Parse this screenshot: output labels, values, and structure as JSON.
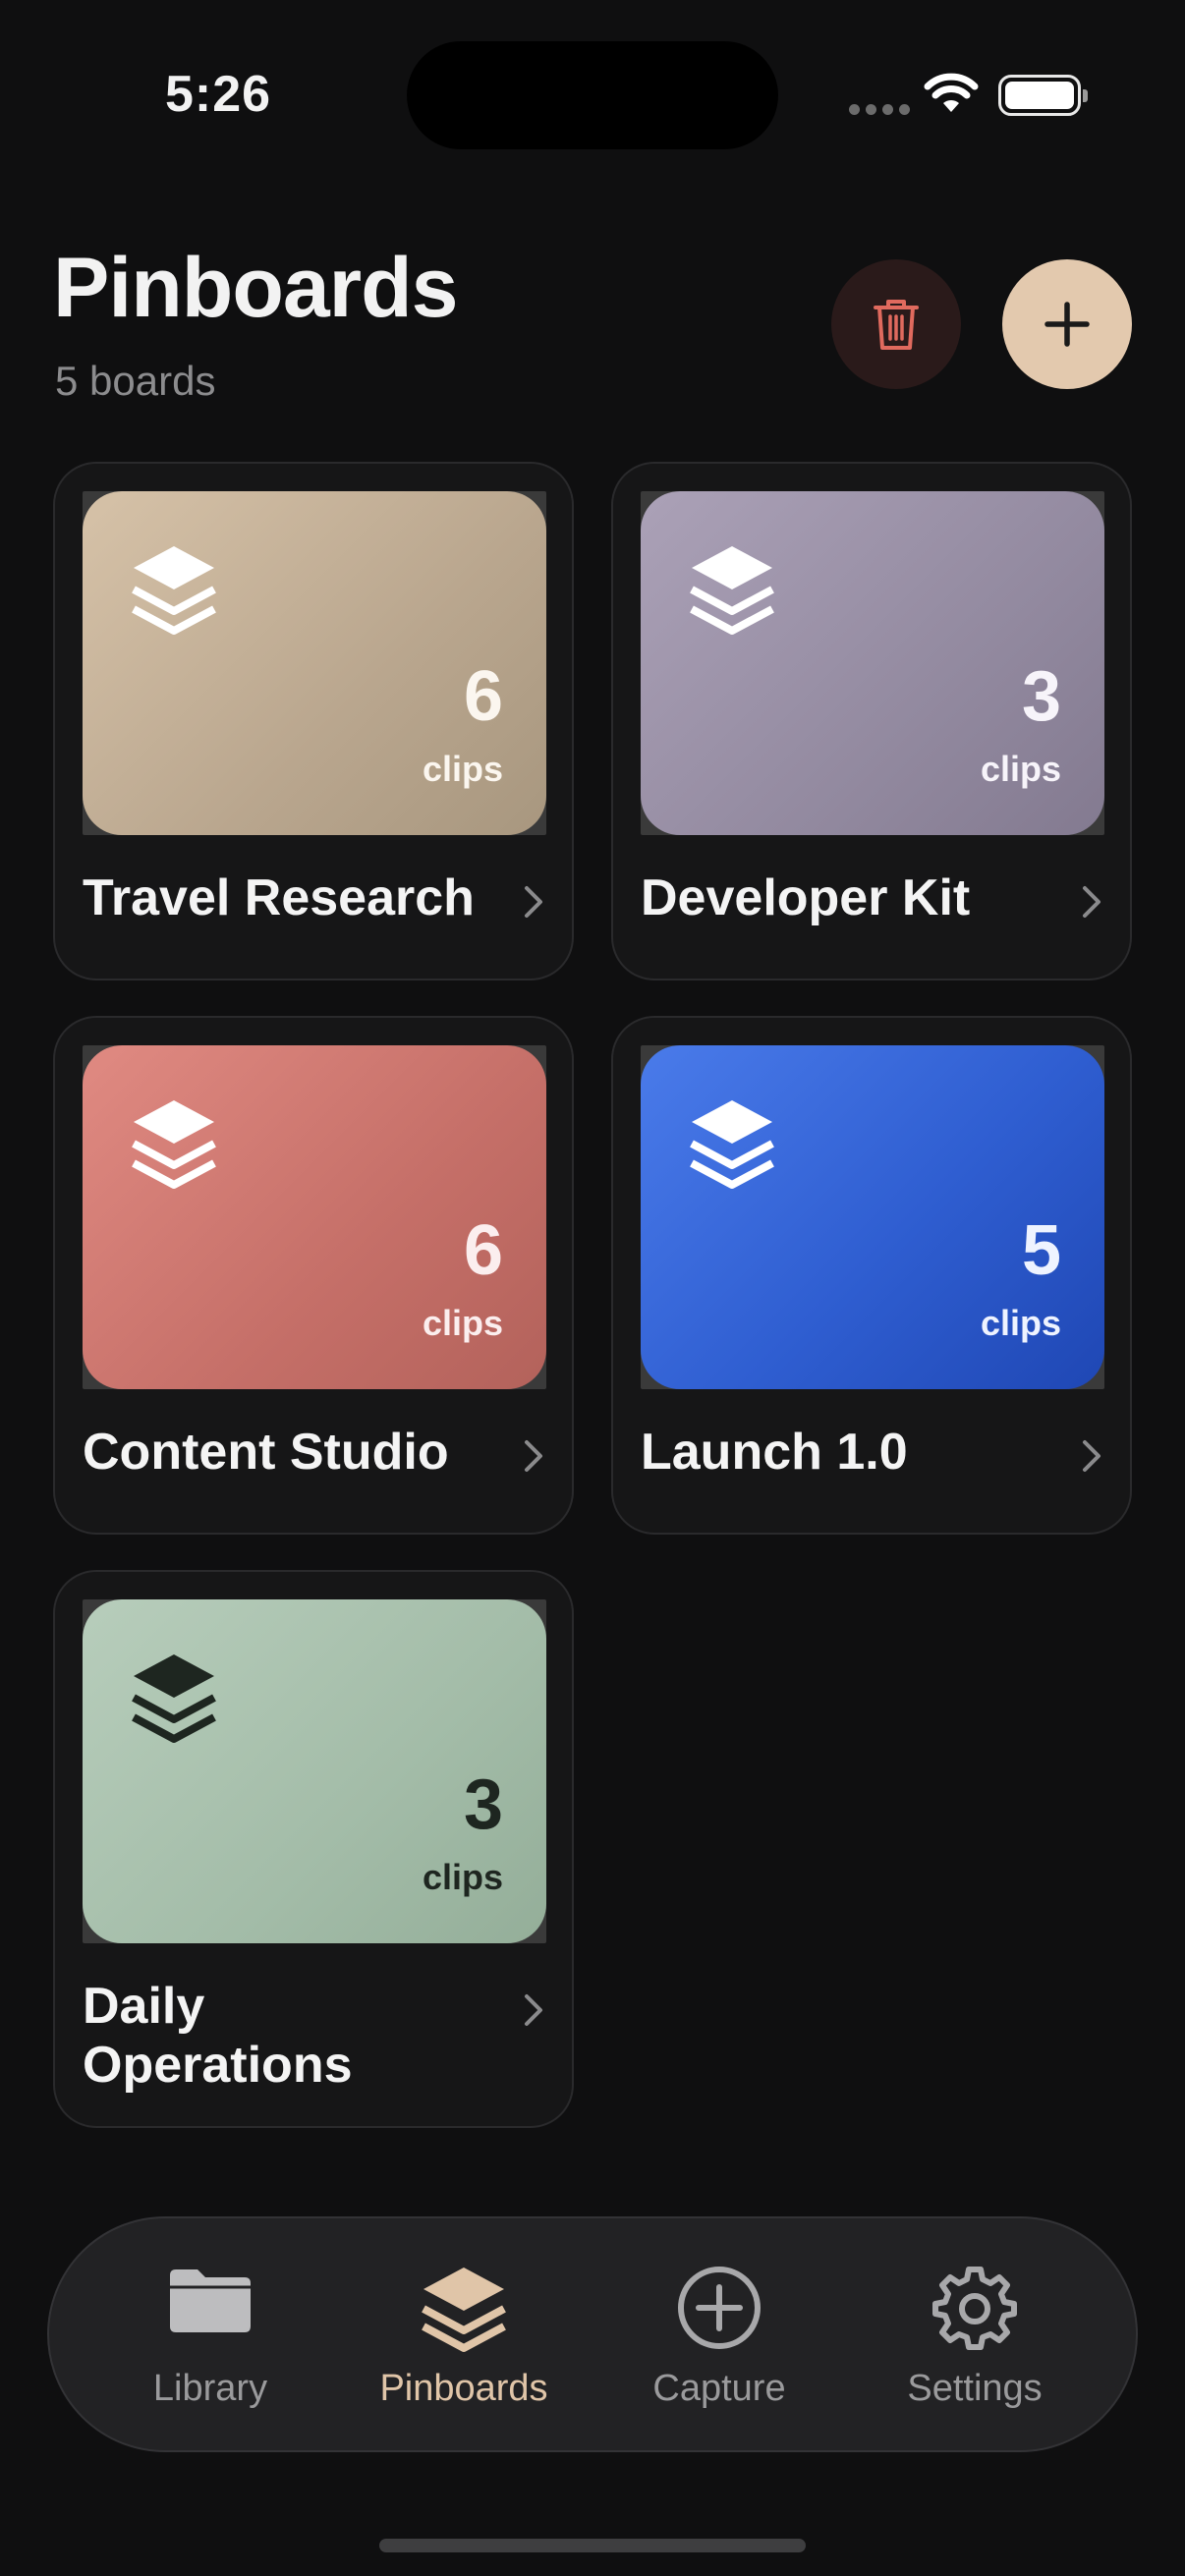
{
  "status_bar": {
    "time": "5:26"
  },
  "header": {
    "title": "Pinboards",
    "subtitle": "5 boards",
    "delete_icon": "trash-icon",
    "add_icon": "plus-icon"
  },
  "boards": [
    {
      "title": "Travel Research",
      "count": "6",
      "unit": "clips",
      "color": "#c9b59c"
    },
    {
      "title": "Developer Kit",
      "count": "3",
      "unit": "clips",
      "color": "#9e95aa"
    },
    {
      "title": "Content Studio",
      "count": "6",
      "unit": "clips",
      "color": "#d27c74"
    },
    {
      "title": "Launch 1.0",
      "count": "5",
      "unit": "clips",
      "color": "#3562d6"
    },
    {
      "title": "Daily\nOperations",
      "count": "3",
      "unit": "clips",
      "color": "#a7bfab"
    }
  ],
  "tabbar": {
    "items": [
      {
        "label": "Library",
        "icon": "folder-icon"
      },
      {
        "label": "Pinboards",
        "icon": "stack-icon",
        "active": true
      },
      {
        "label": "Capture",
        "icon": "plus-circle-icon"
      },
      {
        "label": "Settings",
        "icon": "gear-icon"
      }
    ]
  },
  "colors": {
    "accent": "#e3c9ae",
    "danger": "#e06a5e",
    "background": "#0f0f10"
  }
}
